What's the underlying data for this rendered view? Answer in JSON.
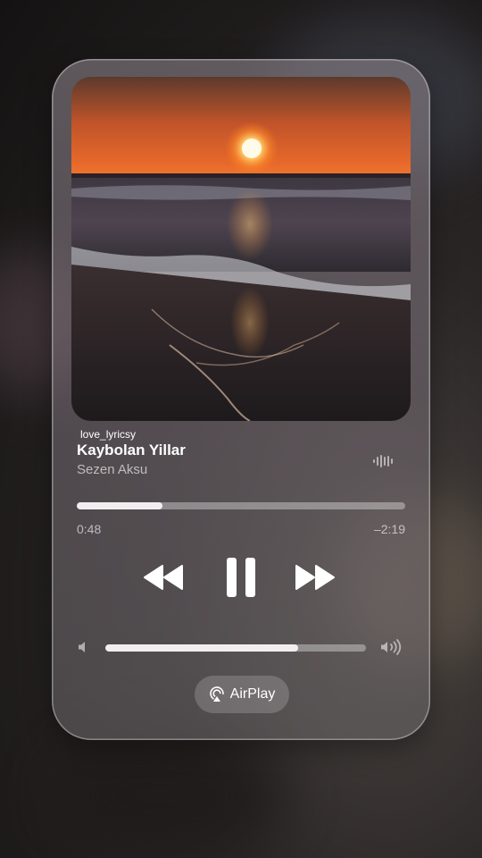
{
  "now_playing": {
    "source_label": "love_lyricsy",
    "title": "Kaybolan Yillar",
    "artist": "Sezen Aksu",
    "artwork_icon": "sunset-beach-artwork"
  },
  "playback": {
    "elapsed": "0:48",
    "remaining": "–2:19",
    "progress_fraction": 0.26,
    "state": "playing"
  },
  "controls": {
    "rewind_icon": "rewind-icon",
    "pause_icon": "pause-icon",
    "forward_icon": "fast-forward-icon"
  },
  "volume": {
    "level_fraction": 0.74,
    "low_icon": "speaker-low-icon",
    "high_icon": "speaker-high-icon"
  },
  "airplay": {
    "label": "AirPlay",
    "icon": "airplay-icon"
  },
  "colors": {
    "text_primary": "#ffffff",
    "text_secondary": "rgba(255,255,255,0.62)",
    "track_fill": "#f2eef0"
  }
}
